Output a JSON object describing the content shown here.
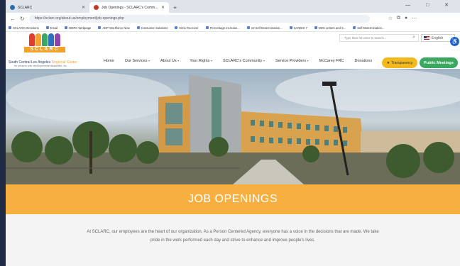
{
  "browser": {
    "tabs": [
      {
        "label": "SCLARC",
        "active": false
      },
      {
        "label": "Job Openings - SCLARC's Comm...",
        "active": true
      }
    ],
    "new_tab": "+",
    "window_controls": "— □ ✕",
    "url": "https://sclarc.org/about-us/employment/job-openings.php",
    "bookmarks": [
      "SCLARC Directions",
      "Email",
      "DDRC Webpage",
      "ADP Workforce Now",
      "Consumer Solutions",
      "Citrix Receiver",
      "Percentage Increase...",
      "10 Self-Determination...",
      "SANDIS 7",
      "DDS Letters and S...",
      "Self-Determination..."
    ]
  },
  "site": {
    "logo_text": "SCLARC",
    "org_name_prefix": "South Central Los Angeles ",
    "org_name_highlight": "Regional Center",
    "org_tagline": "for persons with developmental disabilities, inc.",
    "search_placeholder": "Type then hit enter to search...",
    "language": "English",
    "accessibility_icon": "accessibility-icon",
    "nav": [
      {
        "label": "Home",
        "caret": false
      },
      {
        "label": "Our Services",
        "caret": true
      },
      {
        "label": "About Us",
        "caret": true
      },
      {
        "label": "Your Rights",
        "caret": true
      },
      {
        "label": "SCLARC's Community",
        "caret": true
      },
      {
        "label": "Service Providers",
        "caret": true
      },
      {
        "label": "McCarey FRC",
        "caret": false
      },
      {
        "label": "Donations",
        "caret": false
      }
    ],
    "transparency_button": "Transparency",
    "public_meetings_button": "Public Meetings"
  },
  "banner_title": "JOB OPENINGS",
  "intro_text": "At SCLARC, our employees are the heart of our organization. As a Person Centered Agency, everyone has a voice in the decisions that are made. We take pride in the work performed each day and strive to enhance and improve people's lives.",
  "colors": {
    "banner": "#f7b03f",
    "public_button": "#3aa860",
    "transparency_button": "#f3b91c",
    "nav_text": "#333333"
  }
}
